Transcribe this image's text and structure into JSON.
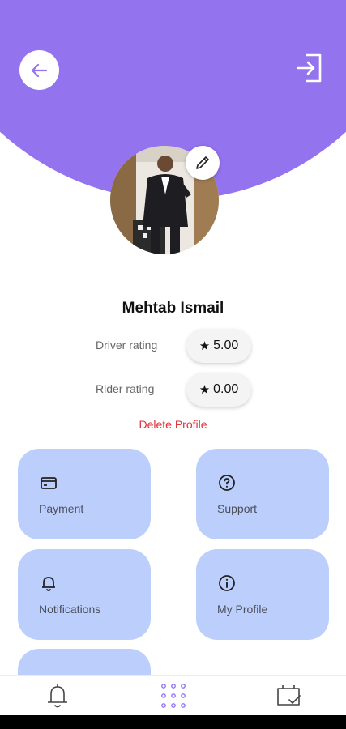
{
  "header": {
    "back_icon": "arrow-left-icon",
    "logout_icon": "logout-icon",
    "accent_color": "#9373ee"
  },
  "profile": {
    "name": "Mehtab Ismail",
    "avatar": "profile-photo",
    "edit_icon": "pencil-icon",
    "ratings": [
      {
        "label": "Driver rating",
        "value": "5.00"
      },
      {
        "label": "Rider rating",
        "value": "0.00"
      }
    ],
    "delete_label": "Delete Profile",
    "delete_color": "#e0303a"
  },
  "menu": {
    "tile_color": "#bccffc",
    "items": [
      {
        "label": "Payment",
        "icon": "credit-card-icon"
      },
      {
        "label": "Support",
        "icon": "help-circle-icon"
      },
      {
        "label": "Notifications",
        "icon": "bell-icon"
      },
      {
        "label": "My Profile",
        "icon": "info-icon"
      },
      {
        "label": "",
        "icon": "more-icon"
      }
    ]
  },
  "bottom_nav": {
    "items": [
      {
        "icon": "bell-icon"
      },
      {
        "icon": "grid-icon",
        "active": true
      },
      {
        "icon": "calendar-check-icon"
      }
    ]
  }
}
